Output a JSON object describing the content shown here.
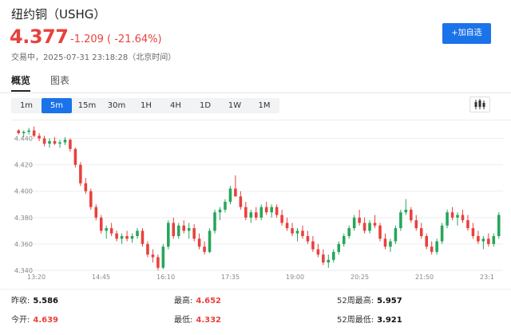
{
  "header": {
    "title": "纽约铜（USHG）",
    "price": "4.377",
    "change": "-1.209 ( -21.64%)",
    "status": "交易中，2025-07-31 23:18:28（北京时间）",
    "add_button": "+加自选"
  },
  "tabs": [
    {
      "label": "概览",
      "active": true
    },
    {
      "label": "图表",
      "active": false
    }
  ],
  "intervals": [
    {
      "label": "1m",
      "active": false
    },
    {
      "label": "5m",
      "active": true
    },
    {
      "label": "15m",
      "active": false
    },
    {
      "label": "30m",
      "active": false
    },
    {
      "label": "1H",
      "active": false
    },
    {
      "label": "4H",
      "active": false
    },
    {
      "label": "1D",
      "active": false
    },
    {
      "label": "1W",
      "active": false
    },
    {
      "label": "1M",
      "active": false
    }
  ],
  "chart_type_icon": "candlestick-icon",
  "colors": {
    "up": "#26a65b",
    "down": "#e8413c",
    "accent": "#1a73e8"
  },
  "stats": {
    "prev_close": {
      "label": "昨收:",
      "value": "5.586"
    },
    "open": {
      "label": "今开:",
      "value": "4.639"
    },
    "high": {
      "label": "最高:",
      "value": "4.652"
    },
    "low": {
      "label": "最低:",
      "value": "4.332"
    },
    "week52_high": {
      "label": "52周最高:",
      "value": "5.957"
    },
    "week52_low": {
      "label": "52周最低:",
      "value": "3.921"
    }
  },
  "chart_data": {
    "type": "candlestick",
    "ylim": [
      4.34,
      4.45
    ],
    "yticks": [
      "4.340",
      "4.360",
      "4.380",
      "4.400",
      "4.420",
      "4.440"
    ],
    "ytick_values": [
      4.34,
      4.36,
      4.38,
      4.4,
      4.42,
      4.44
    ],
    "xticks": [
      "13:20",
      "14:45",
      "16:10",
      "17:35",
      "19:00",
      "20:25",
      "21:50",
      "23:1"
    ],
    "grid": true,
    "candles": [
      [
        4.446,
        4.447,
        4.443,
        4.444
      ],
      [
        4.444,
        4.446,
        4.441,
        4.445
      ],
      [
        4.445,
        4.448,
        4.443,
        4.446
      ],
      [
        4.446,
        4.449,
        4.441,
        4.442
      ],
      [
        4.442,
        4.444,
        4.438,
        4.44
      ],
      [
        4.44,
        4.442,
        4.434,
        4.436
      ],
      [
        4.436,
        4.44,
        4.433,
        4.438
      ],
      [
        4.438,
        4.441,
        4.435,
        4.436
      ],
      [
        4.436,
        4.439,
        4.433,
        4.437
      ],
      [
        4.437,
        4.441,
        4.435,
        4.439
      ],
      [
        4.439,
        4.44,
        4.43,
        4.432
      ],
      [
        4.432,
        4.433,
        4.418,
        4.42
      ],
      [
        4.42,
        4.422,
        4.404,
        4.406
      ],
      [
        4.406,
        4.41,
        4.398,
        4.4
      ],
      [
        4.4,
        4.402,
        4.386,
        4.388
      ],
      [
        4.388,
        4.39,
        4.378,
        4.38
      ],
      [
        4.38,
        4.382,
        4.368,
        4.37
      ],
      [
        4.37,
        4.374,
        4.364,
        4.372
      ],
      [
        4.372,
        4.376,
        4.366,
        4.368
      ],
      [
        4.368,
        4.37,
        4.362,
        4.364
      ],
      [
        4.364,
        4.368,
        4.36,
        4.366
      ],
      [
        4.366,
        4.37,
        4.362,
        4.364
      ],
      [
        4.364,
        4.368,
        4.361,
        4.366
      ],
      [
        4.366,
        4.372,
        4.364,
        4.37
      ],
      [
        4.37,
        4.372,
        4.358,
        4.36
      ],
      [
        4.36,
        4.362,
        4.35,
        4.352
      ],
      [
        4.352,
        4.356,
        4.346,
        4.35
      ],
      [
        4.35,
        4.352,
        4.34,
        4.342
      ],
      [
        4.342,
        4.36,
        4.341,
        4.358
      ],
      [
        4.358,
        4.378,
        4.356,
        4.376
      ],
      [
        4.376,
        4.38,
        4.364,
        4.366
      ],
      [
        4.366,
        4.376,
        4.364,
        4.374
      ],
      [
        4.374,
        4.378,
        4.368,
        4.37
      ],
      [
        4.37,
        4.376,
        4.364,
        4.372
      ],
      [
        4.372,
        4.375,
        4.362,
        4.364
      ],
      [
        4.364,
        4.368,
        4.356,
        4.358
      ],
      [
        4.358,
        4.362,
        4.352,
        4.354
      ],
      [
        4.354,
        4.372,
        4.353,
        4.37
      ],
      [
        4.37,
        4.386,
        4.368,
        4.384
      ],
      [
        4.384,
        4.388,
        4.378,
        4.386
      ],
      [
        4.386,
        4.394,
        4.384,
        4.392
      ],
      [
        4.392,
        4.404,
        4.39,
        4.402
      ],
      [
        4.402,
        4.412,
        4.4,
        4.396
      ],
      [
        4.396,
        4.4,
        4.386,
        4.388
      ],
      [
        4.388,
        4.392,
        4.378,
        4.38
      ],
      [
        4.38,
        4.386,
        4.376,
        4.384
      ],
      [
        4.384,
        4.388,
        4.378,
        4.38
      ],
      [
        4.38,
        4.39,
        4.378,
        4.388
      ],
      [
        4.388,
        4.392,
        4.382,
        4.384
      ],
      [
        4.384,
        4.39,
        4.38,
        4.388
      ],
      [
        4.388,
        4.39,
        4.38,
        4.382
      ],
      [
        4.382,
        4.386,
        4.374,
        4.376
      ],
      [
        4.376,
        4.38,
        4.37,
        4.372
      ],
      [
        4.372,
        4.376,
        4.366,
        4.368
      ],
      [
        4.368,
        4.372,
        4.362,
        4.37
      ],
      [
        4.37,
        4.374,
        4.364,
        4.366
      ],
      [
        4.366,
        4.37,
        4.36,
        4.362
      ],
      [
        4.362,
        4.366,
        4.354,
        4.356
      ],
      [
        4.356,
        4.36,
        4.35,
        4.352
      ],
      [
        4.352,
        4.356,
        4.344,
        4.346
      ],
      [
        4.346,
        4.352,
        4.342,
        4.348
      ],
      [
        4.348,
        4.356,
        4.346,
        4.354
      ],
      [
        4.354,
        4.362,
        4.352,
        4.36
      ],
      [
        4.36,
        4.368,
        4.358,
        4.366
      ],
      [
        4.366,
        4.374,
        4.364,
        4.372
      ],
      [
        4.372,
        4.382,
        4.37,
        4.38
      ],
      [
        4.38,
        4.386,
        4.374,
        4.376
      ],
      [
        4.376,
        4.38,
        4.368,
        4.37
      ],
      [
        4.37,
        4.378,
        4.368,
        4.376
      ],
      [
        4.376,
        4.382,
        4.372,
        4.374
      ],
      [
        4.374,
        4.376,
        4.362,
        4.364
      ],
      [
        4.364,
        4.368,
        4.356,
        4.358
      ],
      [
        4.358,
        4.364,
        4.354,
        4.362
      ],
      [
        4.362,
        4.374,
        4.36,
        4.372
      ],
      [
        4.372,
        4.386,
        4.37,
        4.384
      ],
      [
        4.384,
        4.394,
        4.382,
        4.386
      ],
      [
        4.386,
        4.388,
        4.376,
        4.378
      ],
      [
        4.378,
        4.382,
        4.37,
        4.372
      ],
      [
        4.372,
        4.376,
        4.364,
        4.366
      ],
      [
        4.366,
        4.368,
        4.356,
        4.358
      ],
      [
        4.358,
        4.362,
        4.352,
        4.354
      ],
      [
        4.354,
        4.364,
        4.352,
        4.362
      ],
      [
        4.362,
        4.376,
        4.36,
        4.374
      ],
      [
        4.374,
        4.386,
        4.372,
        4.384
      ],
      [
        4.384,
        4.388,
        4.378,
        4.38
      ],
      [
        4.38,
        4.384,
        4.374,
        4.382
      ],
      [
        4.382,
        4.386,
        4.376,
        4.378
      ],
      [
        4.378,
        4.382,
        4.37,
        4.372
      ],
      [
        4.372,
        4.376,
        4.364,
        4.366
      ],
      [
        4.366,
        4.37,
        4.36,
        4.362
      ],
      [
        4.362,
        4.366,
        4.356,
        4.364
      ],
      [
        4.364,
        4.368,
        4.358,
        4.36
      ],
      [
        4.36,
        4.368,
        4.358,
        4.366
      ],
      [
        4.366,
        4.384,
        4.364,
        4.382
      ]
    ]
  }
}
